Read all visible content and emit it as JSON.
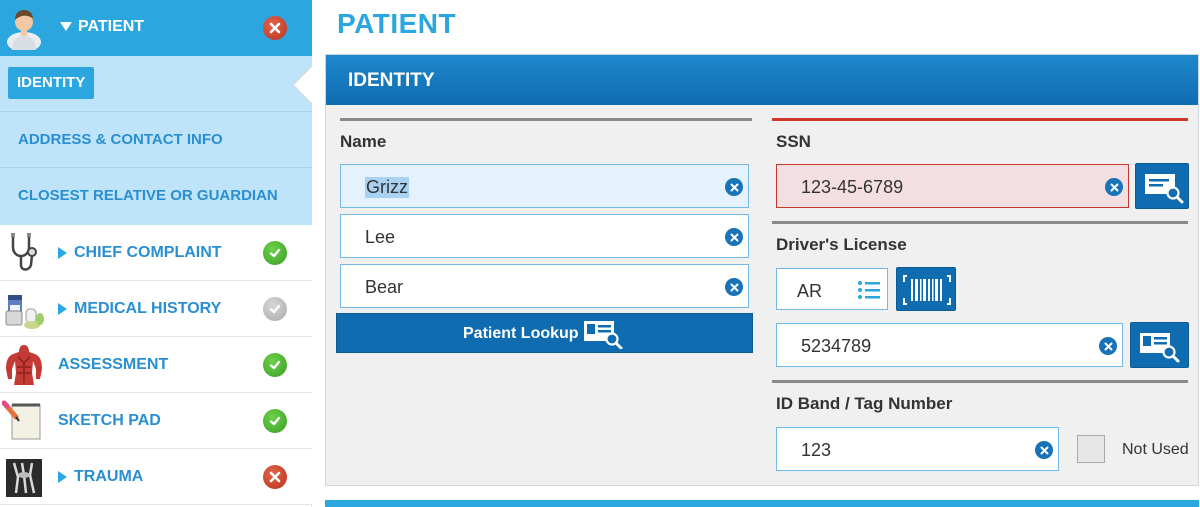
{
  "sidebar": {
    "header": {
      "label": "PATIENT",
      "status": "error",
      "avatar_icon": "patient-avatar-icon"
    },
    "sub_items": [
      {
        "label": "IDENTITY",
        "active": true
      },
      {
        "label": "ADDRESS & CONTACT INFO"
      },
      {
        "label": "CLOSEST RELATIVE OR GUARDIAN"
      }
    ],
    "items": [
      {
        "label": "CHIEF COMPLAINT",
        "icon": "stethoscope-icon",
        "expandable": true,
        "status": "complete"
      },
      {
        "label": "MEDICAL HISTORY",
        "icon": "medications-icon",
        "expandable": true,
        "status": "inactive"
      },
      {
        "label": "ASSESSMENT",
        "icon": "anatomy-icon",
        "expandable": false,
        "status": "complete"
      },
      {
        "label": "SKETCH PAD",
        "icon": "sketch-pad-icon",
        "expandable": false,
        "status": "complete"
      },
      {
        "label": "TRAUMA",
        "icon": "xray-icon",
        "expandable": true,
        "status": "error"
      }
    ]
  },
  "main": {
    "title": "PATIENT",
    "card": {
      "title": "IDENTITY",
      "name": {
        "label": "Name",
        "first": "Grizz",
        "middle": "Lee",
        "last": "Bear",
        "lookup_button": "Patient Lookup"
      },
      "ssn": {
        "label": "SSN",
        "value": "123-45-6789",
        "invalid": true
      },
      "drivers_license": {
        "label": "Driver's License",
        "state": "AR",
        "number": "5234789"
      },
      "id_band": {
        "label": "ID Band / Tag Number",
        "value": "123",
        "not_used_label": "Not Used",
        "not_used": false
      }
    }
  },
  "colors": {
    "accent": "#2ca6df",
    "header_blue": "#0f6cb0",
    "error_red": "#d2382a",
    "success_green": "#4db52f",
    "subnav_bg": "#bfe3f8",
    "error_field_bg": "#f3dfe1"
  }
}
